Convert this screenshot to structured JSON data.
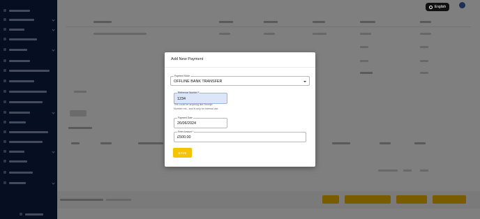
{
  "header": {
    "language_label": "English"
  },
  "modal": {
    "title": "Add New Payment",
    "payment_mode": {
      "label": "Payment Mode",
      "value": "OFFLINE BANK TRANSFER"
    },
    "reference_number": {
      "label": "Reference Number *",
      "value": "1234",
      "helper_line1": "This could be anything like Receipt",
      "helper_line2": "Number etc., and is only for internal use"
    },
    "payment_date": {
      "label": "Payment Date",
      "value": "26/06/2024"
    },
    "amount": {
      "label": "Enter Amount *",
      "value": "£500.00"
    },
    "save_label": "SAVE"
  },
  "icons": {
    "language": "globe-icon",
    "dropdown": "caret-down-icon"
  },
  "colors": {
    "sidebar_bg": "#0c1f45",
    "accent_yellow": "#f5c400",
    "modal_bg": "#ffffff",
    "reference_field_bg": "#dde6f8"
  }
}
